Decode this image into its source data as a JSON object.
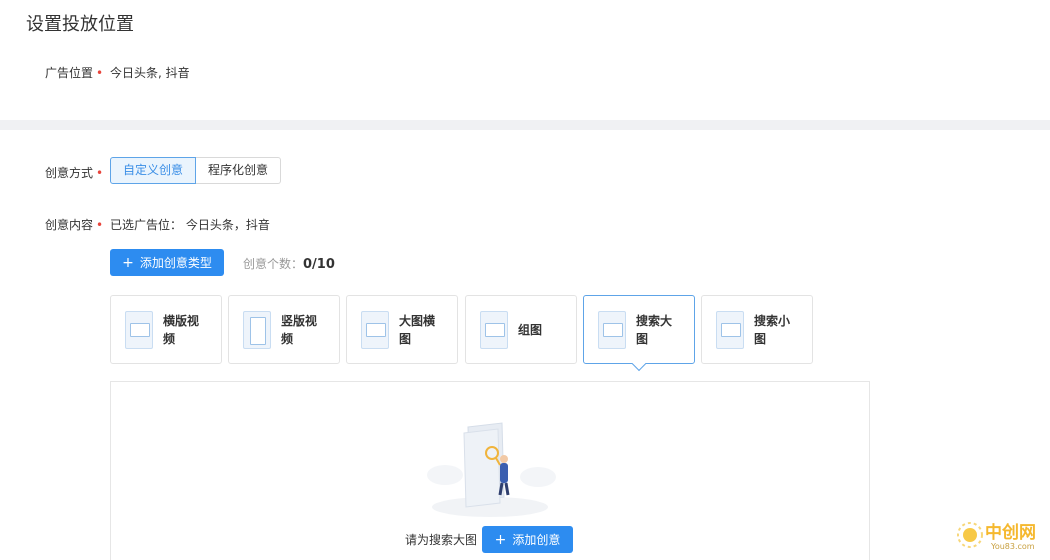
{
  "page_title": "设置投放位置",
  "placement": {
    "label": "广告位置",
    "value": "今日头条, 抖音"
  },
  "creative_mode": {
    "label": "创意方式",
    "options": [
      "自定义创意",
      "程序化创意"
    ],
    "selected": "自定义创意"
  },
  "creative_content": {
    "label": "创意内容",
    "selected_text": "已选广告位：  今日头条，抖音"
  },
  "add_type_button": "添加创意类型",
  "count": {
    "label": "创意个数：",
    "value": "0/10"
  },
  "types": [
    {
      "line1": "横版视",
      "line2": "频",
      "icon": "horizontal-video-icon"
    },
    {
      "line1": "竖版视",
      "line2": "频",
      "icon": "vertical-video-icon"
    },
    {
      "line1": "大图横",
      "line2": "图",
      "icon": "large-image-icon"
    },
    {
      "line1": "组图",
      "line2": "",
      "icon": "group-image-icon"
    },
    {
      "line1": "搜索大",
      "line2": "图",
      "icon": "search-large-image-icon"
    },
    {
      "line1": "搜索小",
      "line2": "图",
      "icon": "search-small-image-icon"
    }
  ],
  "selected_type_index": 4,
  "empty_hint": "请为搜索大图",
  "add_creative_button": "添加创意",
  "watermark": {
    "text": "中创网",
    "sub": "You83.com"
  },
  "colors": {
    "primary": "#2d8cf0",
    "required": "#e8453c",
    "active_border": "#5ea4e8"
  }
}
